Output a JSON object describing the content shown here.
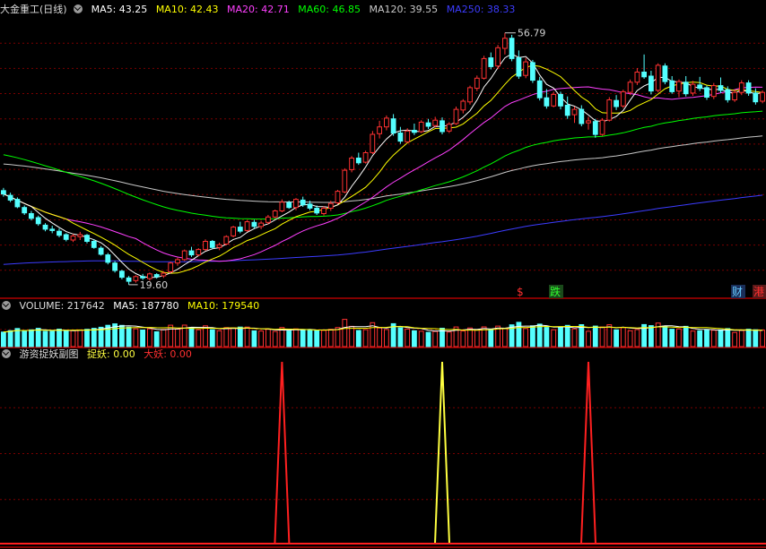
{
  "header_main": {
    "title": "大金重工(日线)",
    "ma": [
      {
        "label": "MA5: 43.25",
        "color": "#ffffff"
      },
      {
        "label": "MA10: 42.43",
        "color": "#ffff00"
      },
      {
        "label": "MA20: 42.71",
        "color": "#ff40ff"
      },
      {
        "label": "MA60: 46.85",
        "color": "#00ff00"
      },
      {
        "label": "MA120: 39.55",
        "color": "#c8c8c8"
      },
      {
        "label": "MA250: 38.33",
        "color": "#3c3cff"
      }
    ]
  },
  "header_volume": {
    "title": "VOLUME: 217642",
    "ma5": "MA5: 187780",
    "ma10": "MA10: 179540"
  },
  "header_indicator": {
    "title": "游资捉妖副图",
    "zhuoyao": "捉妖: 0.00",
    "dayao": "大妖: 0.00"
  },
  "markers": {
    "high": "56.79",
    "low": "19.60",
    "events": [
      {
        "text": "$",
        "color": "#ff3030"
      },
      {
        "text": "跌",
        "color": "#30ff30",
        "bg": "#1a4a1a"
      },
      {
        "text": "财",
        "color": "#66ccff",
        "bg": "#1a2f5a"
      },
      {
        "text": "港",
        "color": "#ff3030",
        "bg": "#5a1a1a"
      }
    ]
  },
  "colors": {
    "up": "#ff3232",
    "down": "#54ffff",
    "grid": "#7a0000",
    "separator": "#b00000"
  },
  "chart_data": [
    {
      "type": "candlestick",
      "title": "大金重工(日线)",
      "ylim": [
        18,
        59
      ],
      "high_label": 56.79,
      "low_label": 19.6,
      "ohlc": [
        [
          33.5,
          33.9,
          32.6,
          33.0
        ],
        [
          32.8,
          33.2,
          31.8,
          32.1
        ],
        [
          32.2,
          32.5,
          30.9,
          31.1
        ],
        [
          31.0,
          31.3,
          29.9,
          30.2
        ],
        [
          30.1,
          30.5,
          29.1,
          29.4
        ],
        [
          29.5,
          29.8,
          28.3,
          28.6
        ],
        [
          28.4,
          28.7,
          27.5,
          27.8
        ],
        [
          27.8,
          28.3,
          27.2,
          27.6
        ],
        [
          27.5,
          27.9,
          26.6,
          26.9
        ],
        [
          27.0,
          27.2,
          26.0,
          26.3
        ],
        [
          26.2,
          27.1,
          25.9,
          26.8
        ],
        [
          26.7,
          27.4,
          26.2,
          27.0
        ],
        [
          26.9,
          27.1,
          25.7,
          26.0
        ],
        [
          26.0,
          26.3,
          24.9,
          25.1
        ],
        [
          25.0,
          25.3,
          23.9,
          24.1
        ],
        [
          24.0,
          24.3,
          22.6,
          22.9
        ],
        [
          22.8,
          23.1,
          21.4,
          21.7
        ],
        [
          21.6,
          21.8,
          20.4,
          20.7
        ],
        [
          20.6,
          20.9,
          19.6,
          20.1
        ],
        [
          20.2,
          21.0,
          19.9,
          20.8
        ],
        [
          20.8,
          21.2,
          20.3,
          20.6
        ],
        [
          20.5,
          21.4,
          20.2,
          21.2
        ],
        [
          21.1,
          21.3,
          20.5,
          20.8
        ],
        [
          20.9,
          21.6,
          20.6,
          21.3
        ],
        [
          21.5,
          23.0,
          21.3,
          22.8
        ],
        [
          22.8,
          23.6,
          22.4,
          23.3
        ],
        [
          23.3,
          24.8,
          23.1,
          24.6
        ],
        [
          24.6,
          25.2,
          23.7,
          24.0
        ],
        [
          24.0,
          25.0,
          23.8,
          24.8
        ],
        [
          24.8,
          26.3,
          24.6,
          26.0
        ],
        [
          26.0,
          26.2,
          24.9,
          25.1
        ],
        [
          25.1,
          25.8,
          24.7,
          25.5
        ],
        [
          25.6,
          26.9,
          25.4,
          26.7
        ],
        [
          26.8,
          28.3,
          26.6,
          28.1
        ],
        [
          28.1,
          28.9,
          27.2,
          27.5
        ],
        [
          27.6,
          29.1,
          27.4,
          28.9
        ],
        [
          28.8,
          29.2,
          27.9,
          28.2
        ],
        [
          28.2,
          29.0,
          27.8,
          28.7
        ],
        [
          28.8,
          29.9,
          28.5,
          29.6
        ],
        [
          29.6,
          30.7,
          29.4,
          30.5
        ],
        [
          30.5,
          32.2,
          30.3,
          31.8
        ],
        [
          31.7,
          32.0,
          30.8,
          31.0
        ],
        [
          31.0,
          32.4,
          30.6,
          32.2
        ],
        [
          32.1,
          32.6,
          31.1,
          31.4
        ],
        [
          31.5,
          32.0,
          30.6,
          30.9
        ],
        [
          30.9,
          31.3,
          29.9,
          30.2
        ],
        [
          30.1,
          31.2,
          29.8,
          30.9
        ],
        [
          30.9,
          32.0,
          30.5,
          31.6
        ],
        [
          31.7,
          33.6,
          31.5,
          33.4
        ],
        [
          33.3,
          36.8,
          33.1,
          36.5
        ],
        [
          36.6,
          38.6,
          36.2,
          38.3
        ],
        [
          38.3,
          39.1,
          37.3,
          37.6
        ],
        [
          37.7,
          39.4,
          37.5,
          39.1
        ],
        [
          39.1,
          42.3,
          38.9,
          41.8
        ],
        [
          41.9,
          43.8,
          41.2,
          42.9
        ],
        [
          42.9,
          44.6,
          42.4,
          44.2
        ],
        [
          44.1,
          44.8,
          41.6,
          42.0
        ],
        [
          42.0,
          42.9,
          40.4,
          40.8
        ],
        [
          40.7,
          42.7,
          40.5,
          42.3
        ],
        [
          42.4,
          43.4,
          41.7,
          42.1
        ],
        [
          42.2,
          43.9,
          42.0,
          43.6
        ],
        [
          43.5,
          44.1,
          42.6,
          43.0
        ],
        [
          43.1,
          44.4,
          42.8,
          43.9
        ],
        [
          43.8,
          44.3,
          41.8,
          42.2
        ],
        [
          42.3,
          43.6,
          42.0,
          43.3
        ],
        [
          43.4,
          45.9,
          43.2,
          45.5
        ],
        [
          45.4,
          47.0,
          44.9,
          46.7
        ],
        [
          46.6,
          49.0,
          46.2,
          48.7
        ],
        [
          48.6,
          50.5,
          48.2,
          50.1
        ],
        [
          50.1,
          53.4,
          49.9,
          53.0
        ],
        [
          53.1,
          53.9,
          51.4,
          51.8
        ],
        [
          51.9,
          55.0,
          51.5,
          54.6
        ],
        [
          54.5,
          56.79,
          53.6,
          56.0
        ],
        [
          56.0,
          56.5,
          52.6,
          53.0
        ],
        [
          53.1,
          54.2,
          50.0,
          50.4
        ],
        [
          50.5,
          53.1,
          50.1,
          52.5
        ],
        [
          52.4,
          52.8,
          49.4,
          49.8
        ],
        [
          49.7,
          50.3,
          46.8,
          47.2
        ],
        [
          47.2,
          48.5,
          45.6,
          46.0
        ],
        [
          46.0,
          48.1,
          45.8,
          47.7
        ],
        [
          47.7,
          48.1,
          45.5,
          46.0
        ],
        [
          46.1,
          47.4,
          44.1,
          44.6
        ],
        [
          44.7,
          45.9,
          43.5,
          45.5
        ],
        [
          45.5,
          46.1,
          43.0,
          43.4
        ],
        [
          43.5,
          44.4,
          42.5,
          43.8
        ],
        [
          43.7,
          44.1,
          41.3,
          41.8
        ],
        [
          41.8,
          44.2,
          41.6,
          43.9
        ],
        [
          43.9,
          47.3,
          43.7,
          46.9
        ],
        [
          46.8,
          47.6,
          45.4,
          45.9
        ],
        [
          46.0,
          48.4,
          45.7,
          48.1
        ],
        [
          48.0,
          49.9,
          47.6,
          49.5
        ],
        [
          49.5,
          51.6,
          49.1,
          51.0
        ],
        [
          51.0,
          53.6,
          50.0,
          50.3
        ],
        [
          50.4,
          51.2,
          47.7,
          48.2
        ],
        [
          48.3,
          52.3,
          48.0,
          52.0
        ],
        [
          51.9,
          52.3,
          49.2,
          49.6
        ],
        [
          49.7,
          50.4,
          47.8,
          48.1
        ],
        [
          48.2,
          49.9,
          47.3,
          49.6
        ],
        [
          49.5,
          50.4,
          47.4,
          47.8
        ],
        [
          47.9,
          49.7,
          47.5,
          49.2
        ],
        [
          49.1,
          50.3,
          48.2,
          48.6
        ],
        [
          48.7,
          49.0,
          46.9,
          47.3
        ],
        [
          47.4,
          49.4,
          47.0,
          49.0
        ],
        [
          49.0,
          50.2,
          47.9,
          48.3
        ],
        [
          48.4,
          48.9,
          46.5,
          46.9
        ],
        [
          46.9,
          48.4,
          46.6,
          48.0
        ],
        [
          48.0,
          49.8,
          47.6,
          49.4
        ],
        [
          49.4,
          49.8,
          47.5,
          47.9
        ],
        [
          47.9,
          48.6,
          46.2,
          46.6
        ],
        [
          46.7,
          48.3,
          46.4,
          48.0
        ]
      ],
      "ma_values": {
        "MA5": 43.25,
        "MA10": 42.43,
        "MA20": 42.71,
        "MA60": 46.85,
        "MA120": 39.55,
        "MA250": 38.33
      }
    },
    {
      "type": "bar",
      "title": "VOLUME",
      "latest": 217642,
      "ma5": 187780,
      "ma10": 179540,
      "ylim": [
        0,
        440000
      ]
    },
    {
      "type": "line",
      "title": "游资捉妖副图",
      "series": [
        {
          "name": "捉妖",
          "color": "#ffff40",
          "spikes_at": [
            63
          ]
        },
        {
          "name": "大妖",
          "color": "#ff2020",
          "spikes_at": [
            40,
            84
          ]
        }
      ],
      "values_now": {
        "捉妖": 0.0,
        "大妖": 0.0
      }
    }
  ]
}
